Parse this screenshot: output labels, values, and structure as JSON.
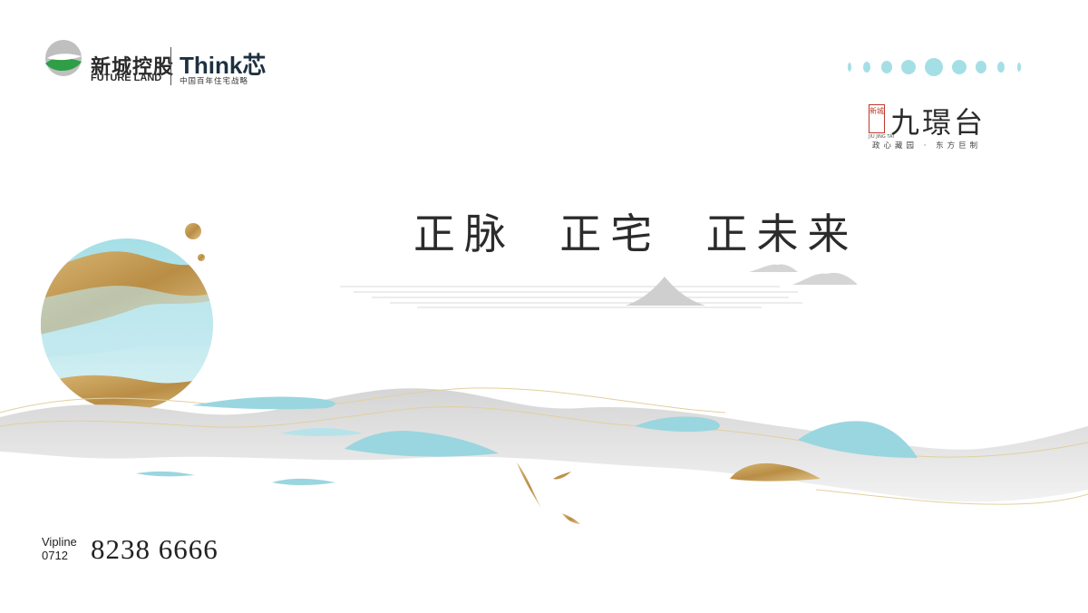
{
  "brand": {
    "name_cn": "新城控股",
    "name_en": "FUTURE LAND",
    "partner": "Think芯",
    "partner_sub": "中国百年住宅战略"
  },
  "project": {
    "seal": "新城",
    "seal_en": "JIU JING TAI",
    "name": "九璟台",
    "slogan": "政心藏园 · 东方巨制"
  },
  "headline": "正脉  正宅  正未来",
  "vip": {
    "label": "Vipline",
    "area_code": "0712",
    "number": "8238 6666"
  },
  "colors": {
    "teal": "#9ad6df",
    "gold": "#c9a25a",
    "grey": "#d9d9d9",
    "text": "#2b2b2b"
  }
}
